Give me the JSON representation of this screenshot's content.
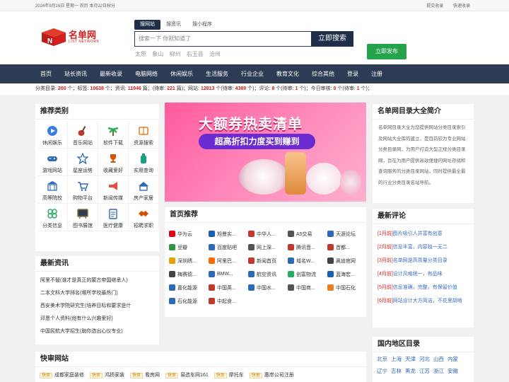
{
  "topbar": {
    "date": "2024年9月16日 星期一 农历 本月22日秋分",
    "link1": "提交收录",
    "link2": "快速收录"
  },
  "logo": {
    "cn": "名单网",
    "en": "LIST NETWORK"
  },
  "search": {
    "tabs": [
      "搜网站",
      "搜资讯",
      "搜小程序"
    ],
    "placeholder": "搜索一下 你就知道了",
    "button": "立即搜索",
    "hot": [
      "太原",
      "象山",
      "柳州",
      "右玉县",
      "沧州"
    ]
  },
  "publish_button": "立即发布",
  "nav": [
    "首页",
    "站长资讯",
    "最新收录",
    "电脑网络",
    "休闲娱乐",
    "生活服务",
    "行业企业",
    "教育文化",
    "综合其他",
    "登录",
    "注册"
  ],
  "stats": {
    "l1": "分类目录:",
    "v1": "200",
    "s1": "个；标签:",
    "v2": "10638",
    "s2": "个；资讯:",
    "v3": "11946",
    "s3": "篇；(待审:",
    "v4": "221",
    "s4": "篇)；网站:",
    "v5": "12813",
    "s5": "个(待审:",
    "v6": "4389",
    "s6": "个)；评论:",
    "v7": "8",
    "s7": "个(待审:",
    "v8": "1",
    "s8": "个)；今日审核:",
    "v9": "0",
    "s9": "个(待审:",
    "v10": "1",
    "s10": "个)；"
  },
  "categories": {
    "title": "推荐类别",
    "items": [
      {
        "label": "休闲娱乐",
        "icon": "play-icon",
        "color": "#3a7de0"
      },
      {
        "label": "音乐网站",
        "icon": "guitar-icon",
        "color": "#c0392b"
      },
      {
        "label": "软件下载",
        "icon": "palm-icon",
        "color": "#27ae60"
      },
      {
        "label": "资源搜索",
        "icon": "book-icon",
        "color": "#e67e22"
      },
      {
        "label": "游戏网站",
        "icon": "gamepad-icon",
        "color": "#2f6ab8"
      },
      {
        "label": "星座运势",
        "icon": "star-icon",
        "color": "#2f6ab8"
      },
      {
        "label": "收藏爱好",
        "icon": "trophy-icon",
        "color": "#d35400"
      },
      {
        "label": "实用查询",
        "icon": "bottle-icon",
        "color": "#16a085"
      },
      {
        "label": "高等院校",
        "icon": "building-icon",
        "color": "#2f6ab8"
      },
      {
        "label": "购物平台",
        "icon": "cart-icon",
        "color": "#2f6ab8"
      },
      {
        "label": "新闻传媒",
        "icon": "megaphone-icon",
        "color": "#e74c3c"
      },
      {
        "label": "房产家居",
        "icon": "house-icon",
        "color": "#2f6ab8"
      },
      {
        "label": "分类信息",
        "icon": "grid-icon",
        "color": "#27ae60"
      },
      {
        "label": "图书展馆",
        "icon": "blackboard-icon",
        "color": "#8e6e3a"
      },
      {
        "label": "医疗健康",
        "icon": "clipboard-icon",
        "color": "#2f6ab8"
      },
      {
        "label": "招聘求职",
        "icon": "handshake-icon",
        "color": "#d35400"
      }
    ]
  },
  "news": {
    "title": "最新资讯",
    "items": [
      "阿里不替(谁才是真正的蒙古帝国继承人)",
      "二本文科大学排名(哪所学校最热门)",
      "西安美术学院研究生(培养目标和要求是什",
      "邓恩个人资料(他有什么兴趣爱好)",
      "中国民航大学招生(助你选出心仪专业)"
    ]
  },
  "banner": {
    "line1": "大额券热卖清单",
    "line2": "超高折扣力度买到赚到"
  },
  "recommend": {
    "title": "首页推荐",
    "items": [
      {
        "label": "华为云",
        "color": "#e60012"
      },
      {
        "label": "旭曼实...",
        "color": "#1a5fb4"
      },
      {
        "label": "中华人...",
        "color": "#c0392b"
      },
      {
        "label": "A5交易",
        "color": "#555"
      },
      {
        "label": "天涯论坛",
        "color": "#2f6ab8"
      },
      {
        "label": "豆瓣",
        "color": "#2e963d"
      },
      {
        "label": "百度贴吧",
        "color": "#2f6ab8"
      },
      {
        "label": "网上深...",
        "color": "#555"
      },
      {
        "label": "腾讯音...",
        "color": "#c0392b"
      },
      {
        "label": "首都...",
        "color": "#c0392b"
      },
      {
        "label": "深圳绣...",
        "color": "#e6a100"
      },
      {
        "label": "阿里巴...",
        "color": "#ff6a00"
      },
      {
        "label": "新闻首页",
        "color": "#c0392b"
      },
      {
        "label": "域名W...",
        "color": "#2f6ab8"
      },
      {
        "label": "奥迪官网",
        "color": "#444"
      },
      {
        "label": "梅赛德...",
        "color": "#444"
      },
      {
        "label": "BMW...",
        "color": "#2f6ab8"
      },
      {
        "label": "航空资讯",
        "color": "#2f6ab8"
      },
      {
        "label": "创富物流",
        "color": "#27ae60"
      },
      {
        "label": "蓝海宏...",
        "color": "#1a5fb4"
      },
      {
        "label": "嘉化能源",
        "color": "#2f6ab8"
      },
      {
        "label": "中国英...",
        "color": "#c0392b"
      },
      {
        "label": "中国水...",
        "color": "#2f6ab8"
      },
      {
        "label": "中国商...",
        "color": "#555"
      },
      {
        "label": "中国石化",
        "color": "#e67e22"
      },
      {
        "label": "石化能源",
        "color": "#2f6ab8"
      },
      {
        "label": "中起食...",
        "color": "#c0392b"
      }
    ]
  },
  "intro": {
    "title": "名单网目录大全简介",
    "text": "名单网目录大全为您提供网站分类目录索引及网站大全库的建立，是目前较为专业网站分类目录网，为用户打造大型正规分类目录网，旨在为用户提供高效便捷的网址存储和查询服务的分类目录网站，同时提供最全最的行业分类目录名站导航。"
  },
  "comments": {
    "title": "最新评论",
    "items": [
      {
        "n": "[1月前]",
        "t": "图片吸引人并富有创意"
      },
      {
        "n": "[2月前]",
        "t": "信息丰富，内容独一无二"
      },
      {
        "n": "[3月前]",
        "t": "名单网是高质量分类目录"
      },
      {
        "n": "[4月前]",
        "t": "设计风格统一，有品味"
      },
      {
        "n": "[5月前]",
        "t": "信息准确，完整，有保留价值"
      },
      {
        "n": "[6月前]",
        "t": "网站设计大方简洁，不花里胡哨"
      }
    ]
  },
  "regions": {
    "title": "国内地区目录",
    "items": [
      "北京",
      "上海",
      "天津",
      "河北",
      "山西",
      "内蒙",
      "辽宁",
      "吉林",
      "黑龙",
      "江苏",
      "浙江",
      "安徽"
    ]
  },
  "quick": {
    "title": "快审网站",
    "tag": "快审",
    "items": [
      "成都家庭装修",
      "鸿扬家装",
      "看房网",
      "易选车网161",
      "摩托车",
      "惠岸公司注册"
    ]
  }
}
